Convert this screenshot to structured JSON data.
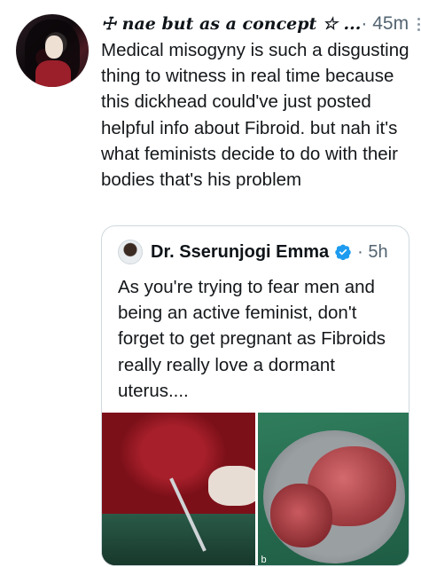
{
  "tweet": {
    "author_name": "☩ nae but as a concept ☆ ...",
    "time": "· 45m",
    "text": "Medical misogyny is such a disgusting thing to witness in real time because this dickhead could've just posted helpful info about Fibroid. but nah it's what feminists decide to do with their bodies that's his problem"
  },
  "quoted_tweet": {
    "author_name": "Dr. Sserunjogi Emma",
    "time": "· 5h",
    "text": "As you're trying to fear men and being an active feminist, don't forget to get pregnant as Fibroids really really love a dormant uterus....",
    "media_mark": "b"
  },
  "colors": {
    "verified": "#1d9bf0",
    "muted_text": "#536471",
    "border": "#cfd9de"
  }
}
